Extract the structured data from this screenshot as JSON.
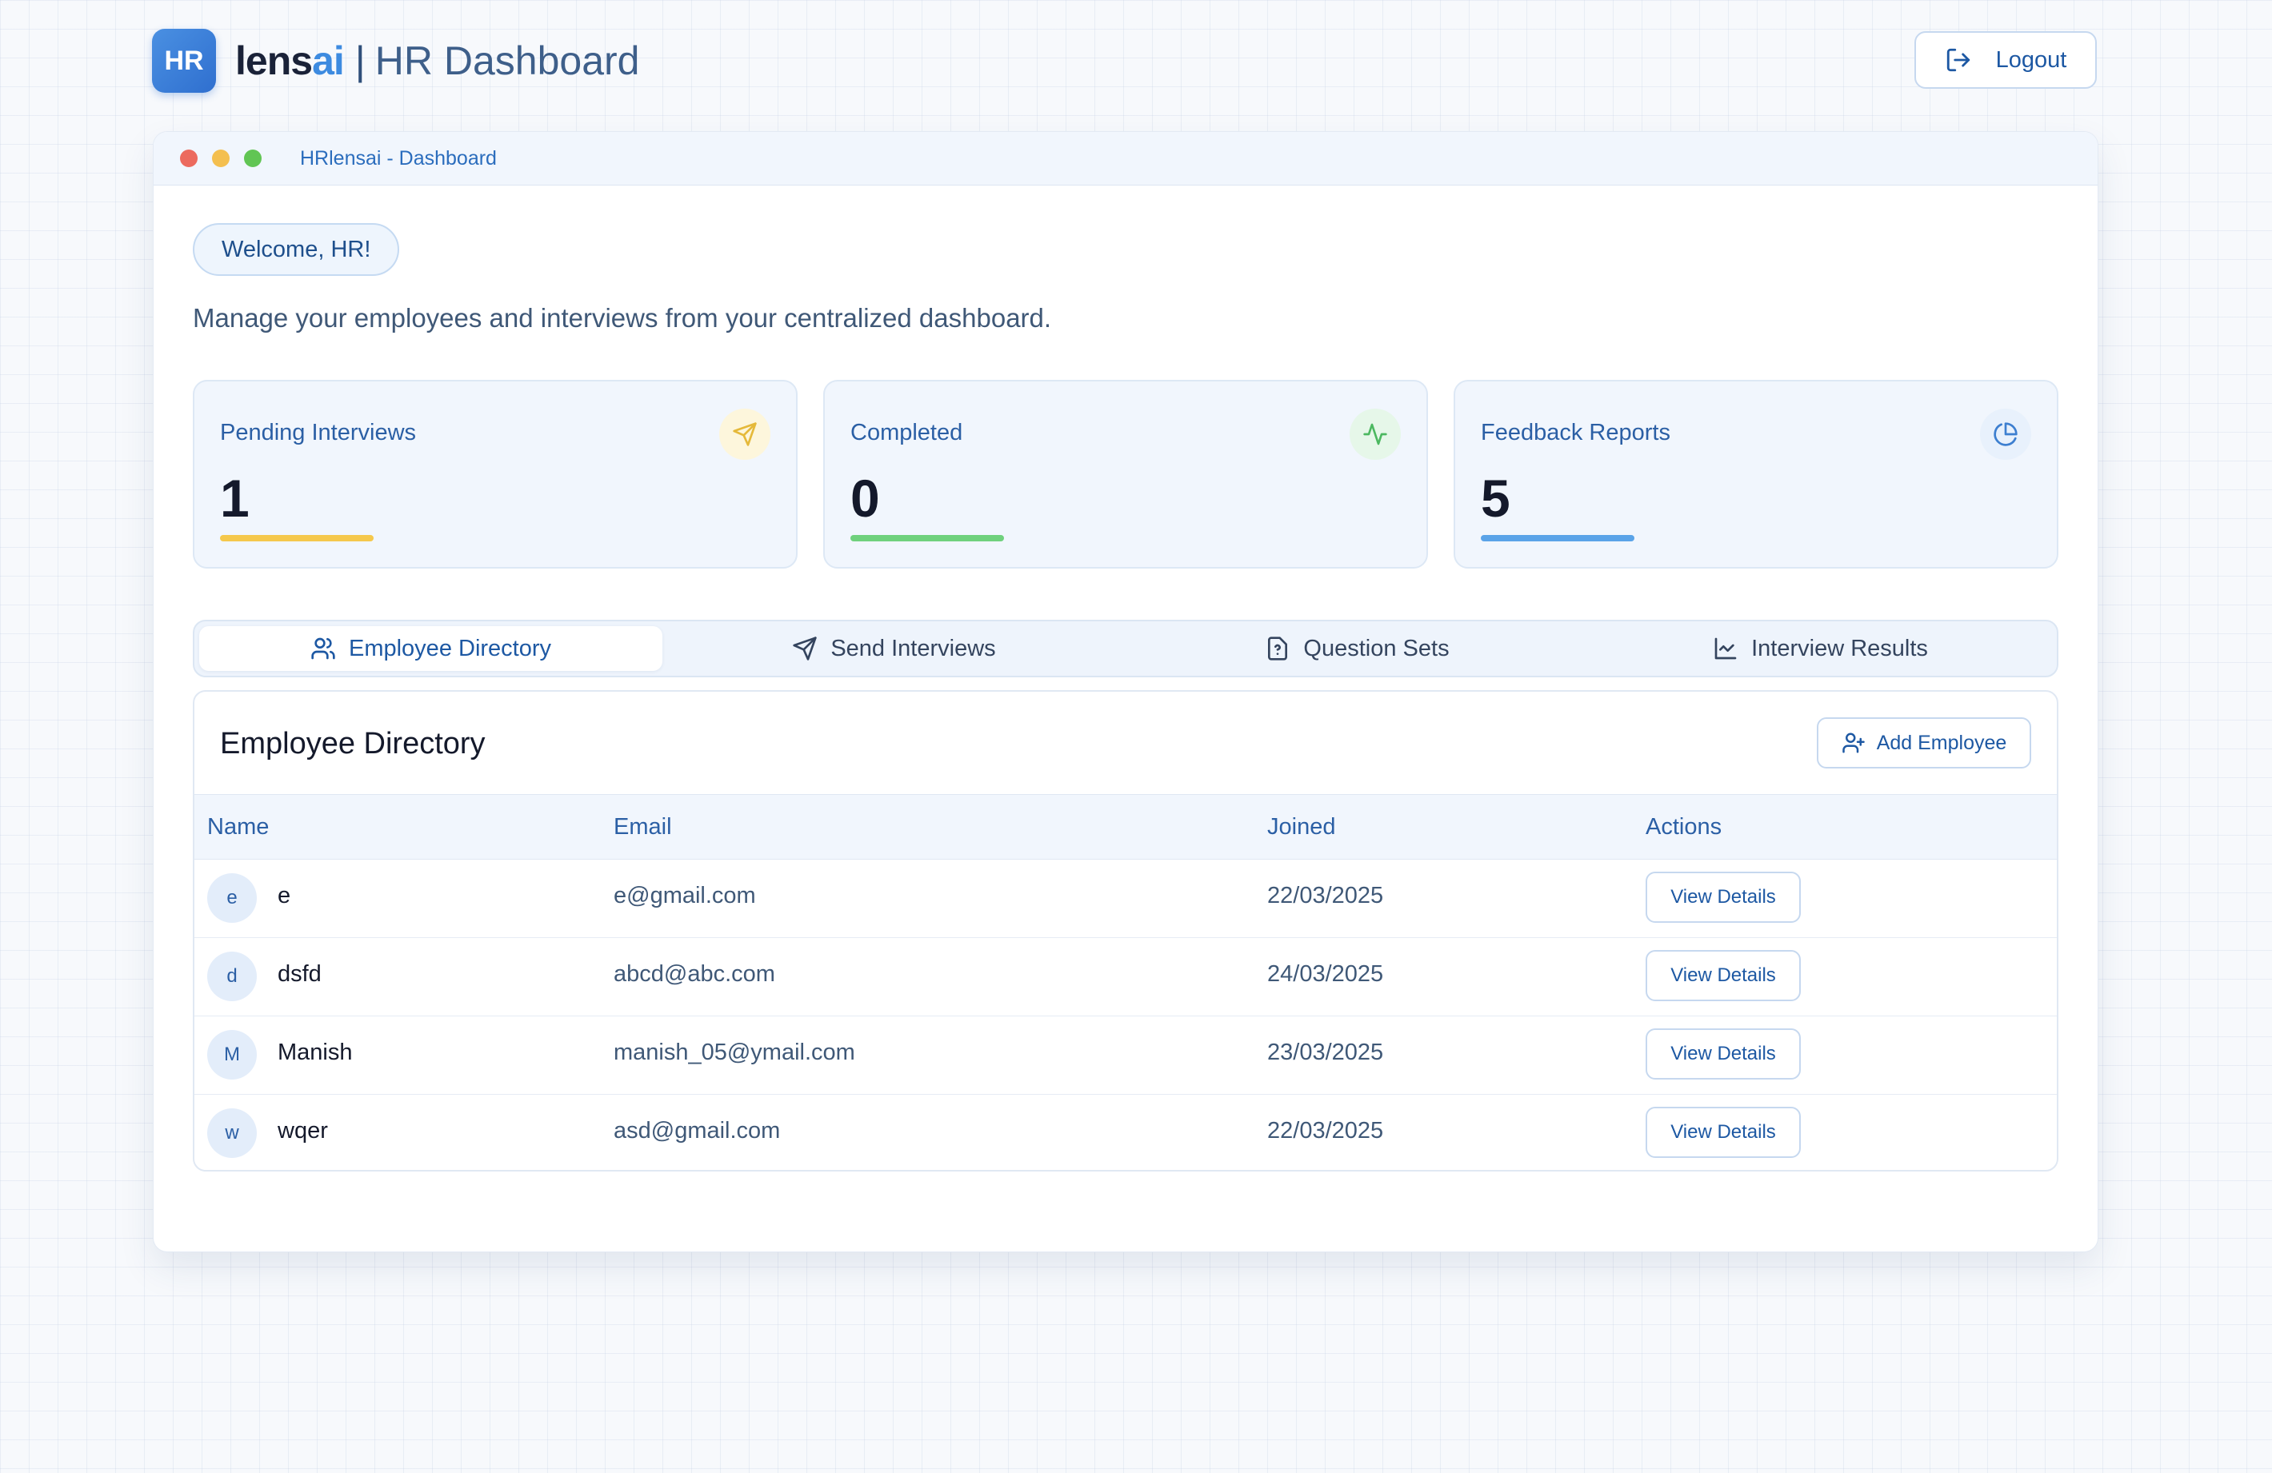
{
  "header": {
    "badge": "HR",
    "brand_part1": "lens",
    "brand_part2": "ai",
    "divider": "|",
    "title": "HR Dashboard",
    "logout_label": "Logout"
  },
  "window": {
    "title": "HRlensai - Dashboard"
  },
  "welcome": {
    "pill": "Welcome, HR!",
    "subtitle": "Manage your employees and interviews from your centralized dashboard."
  },
  "stats": [
    {
      "label": "Pending Interviews",
      "value": "1",
      "icon": "send-icon",
      "color": "#f5c84c"
    },
    {
      "label": "Completed",
      "value": "0",
      "icon": "activity-icon",
      "color": "#6fd17d"
    },
    {
      "label": "Feedback Reports",
      "value": "5",
      "icon": "pie-chart-icon",
      "color": "#5aa3e8"
    }
  ],
  "tabs": [
    {
      "label": "Employee Directory",
      "icon": "users-icon",
      "active": true
    },
    {
      "label": "Send Interviews",
      "icon": "send-icon",
      "active": false
    },
    {
      "label": "Question Sets",
      "icon": "file-question-icon",
      "active": false
    },
    {
      "label": "Interview Results",
      "icon": "line-chart-icon",
      "active": false
    }
  ],
  "directory": {
    "title": "Employee Directory",
    "add_label": "Add Employee",
    "columns": [
      "Name",
      "Email",
      "Joined",
      "Actions"
    ],
    "rows": [
      {
        "initial": "e",
        "name": "e",
        "email": "e@gmail.com",
        "joined": "22/03/2025",
        "action": "View Details"
      },
      {
        "initial": "d",
        "name": "dsfd",
        "email": "abcd@abc.com",
        "joined": "24/03/2025",
        "action": "View Details"
      },
      {
        "initial": "M",
        "name": "Manish",
        "email": "manish_05@ymail.com",
        "joined": "23/03/2025",
        "action": "View Details"
      },
      {
        "initial": "w",
        "name": "wqer",
        "email": "asd@gmail.com",
        "joined": "22/03/2025",
        "action": "View Details"
      }
    ]
  },
  "colors": {
    "accent": "#1d58a3",
    "brand_ai": "#3d8be0",
    "pending_bar": "#f5c84c",
    "completed_bar": "#6fd17d",
    "feedback_bar": "#5aa3e8"
  }
}
